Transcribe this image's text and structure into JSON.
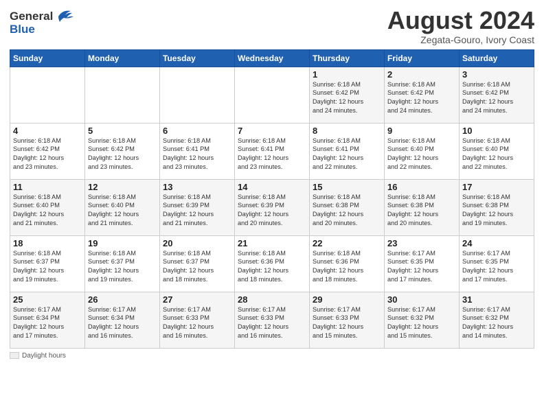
{
  "header": {
    "logo_general": "General",
    "logo_blue": "Blue",
    "month_title": "August 2024",
    "subtitle": "Zegata-Gouro, Ivory Coast"
  },
  "weekdays": [
    "Sunday",
    "Monday",
    "Tuesday",
    "Wednesday",
    "Thursday",
    "Friday",
    "Saturday"
  ],
  "weeks": [
    [
      {
        "day": "",
        "info": ""
      },
      {
        "day": "",
        "info": ""
      },
      {
        "day": "",
        "info": ""
      },
      {
        "day": "",
        "info": ""
      },
      {
        "day": "1",
        "info": "Sunrise: 6:18 AM\nSunset: 6:42 PM\nDaylight: 12 hours\nand 24 minutes."
      },
      {
        "day": "2",
        "info": "Sunrise: 6:18 AM\nSunset: 6:42 PM\nDaylight: 12 hours\nand 24 minutes."
      },
      {
        "day": "3",
        "info": "Sunrise: 6:18 AM\nSunset: 6:42 PM\nDaylight: 12 hours\nand 24 minutes."
      }
    ],
    [
      {
        "day": "4",
        "info": "Sunrise: 6:18 AM\nSunset: 6:42 PM\nDaylight: 12 hours\nand 23 minutes."
      },
      {
        "day": "5",
        "info": "Sunrise: 6:18 AM\nSunset: 6:42 PM\nDaylight: 12 hours\nand 23 minutes."
      },
      {
        "day": "6",
        "info": "Sunrise: 6:18 AM\nSunset: 6:41 PM\nDaylight: 12 hours\nand 23 minutes."
      },
      {
        "day": "7",
        "info": "Sunrise: 6:18 AM\nSunset: 6:41 PM\nDaylight: 12 hours\nand 23 minutes."
      },
      {
        "day": "8",
        "info": "Sunrise: 6:18 AM\nSunset: 6:41 PM\nDaylight: 12 hours\nand 22 minutes."
      },
      {
        "day": "9",
        "info": "Sunrise: 6:18 AM\nSunset: 6:40 PM\nDaylight: 12 hours\nand 22 minutes."
      },
      {
        "day": "10",
        "info": "Sunrise: 6:18 AM\nSunset: 6:40 PM\nDaylight: 12 hours\nand 22 minutes."
      }
    ],
    [
      {
        "day": "11",
        "info": "Sunrise: 6:18 AM\nSunset: 6:40 PM\nDaylight: 12 hours\nand 21 minutes."
      },
      {
        "day": "12",
        "info": "Sunrise: 6:18 AM\nSunset: 6:40 PM\nDaylight: 12 hours\nand 21 minutes."
      },
      {
        "day": "13",
        "info": "Sunrise: 6:18 AM\nSunset: 6:39 PM\nDaylight: 12 hours\nand 21 minutes."
      },
      {
        "day": "14",
        "info": "Sunrise: 6:18 AM\nSunset: 6:39 PM\nDaylight: 12 hours\nand 20 minutes."
      },
      {
        "day": "15",
        "info": "Sunrise: 6:18 AM\nSunset: 6:38 PM\nDaylight: 12 hours\nand 20 minutes."
      },
      {
        "day": "16",
        "info": "Sunrise: 6:18 AM\nSunset: 6:38 PM\nDaylight: 12 hours\nand 20 minutes."
      },
      {
        "day": "17",
        "info": "Sunrise: 6:18 AM\nSunset: 6:38 PM\nDaylight: 12 hours\nand 19 minutes."
      }
    ],
    [
      {
        "day": "18",
        "info": "Sunrise: 6:18 AM\nSunset: 6:37 PM\nDaylight: 12 hours\nand 19 minutes."
      },
      {
        "day": "19",
        "info": "Sunrise: 6:18 AM\nSunset: 6:37 PM\nDaylight: 12 hours\nand 19 minutes."
      },
      {
        "day": "20",
        "info": "Sunrise: 6:18 AM\nSunset: 6:37 PM\nDaylight: 12 hours\nand 18 minutes."
      },
      {
        "day": "21",
        "info": "Sunrise: 6:18 AM\nSunset: 6:36 PM\nDaylight: 12 hours\nand 18 minutes."
      },
      {
        "day": "22",
        "info": "Sunrise: 6:18 AM\nSunset: 6:36 PM\nDaylight: 12 hours\nand 18 minutes."
      },
      {
        "day": "23",
        "info": "Sunrise: 6:17 AM\nSunset: 6:35 PM\nDaylight: 12 hours\nand 17 minutes."
      },
      {
        "day": "24",
        "info": "Sunrise: 6:17 AM\nSunset: 6:35 PM\nDaylight: 12 hours\nand 17 minutes."
      }
    ],
    [
      {
        "day": "25",
        "info": "Sunrise: 6:17 AM\nSunset: 6:34 PM\nDaylight: 12 hours\nand 17 minutes."
      },
      {
        "day": "26",
        "info": "Sunrise: 6:17 AM\nSunset: 6:34 PM\nDaylight: 12 hours\nand 16 minutes."
      },
      {
        "day": "27",
        "info": "Sunrise: 6:17 AM\nSunset: 6:33 PM\nDaylight: 12 hours\nand 16 minutes."
      },
      {
        "day": "28",
        "info": "Sunrise: 6:17 AM\nSunset: 6:33 PM\nDaylight: 12 hours\nand 16 minutes."
      },
      {
        "day": "29",
        "info": "Sunrise: 6:17 AM\nSunset: 6:33 PM\nDaylight: 12 hours\nand 15 minutes."
      },
      {
        "day": "30",
        "info": "Sunrise: 6:17 AM\nSunset: 6:32 PM\nDaylight: 12 hours\nand 15 minutes."
      },
      {
        "day": "31",
        "info": "Sunrise: 6:17 AM\nSunset: 6:32 PM\nDaylight: 12 hours\nand 14 minutes."
      }
    ]
  ],
  "legend": {
    "box_label": "Daylight hours"
  }
}
